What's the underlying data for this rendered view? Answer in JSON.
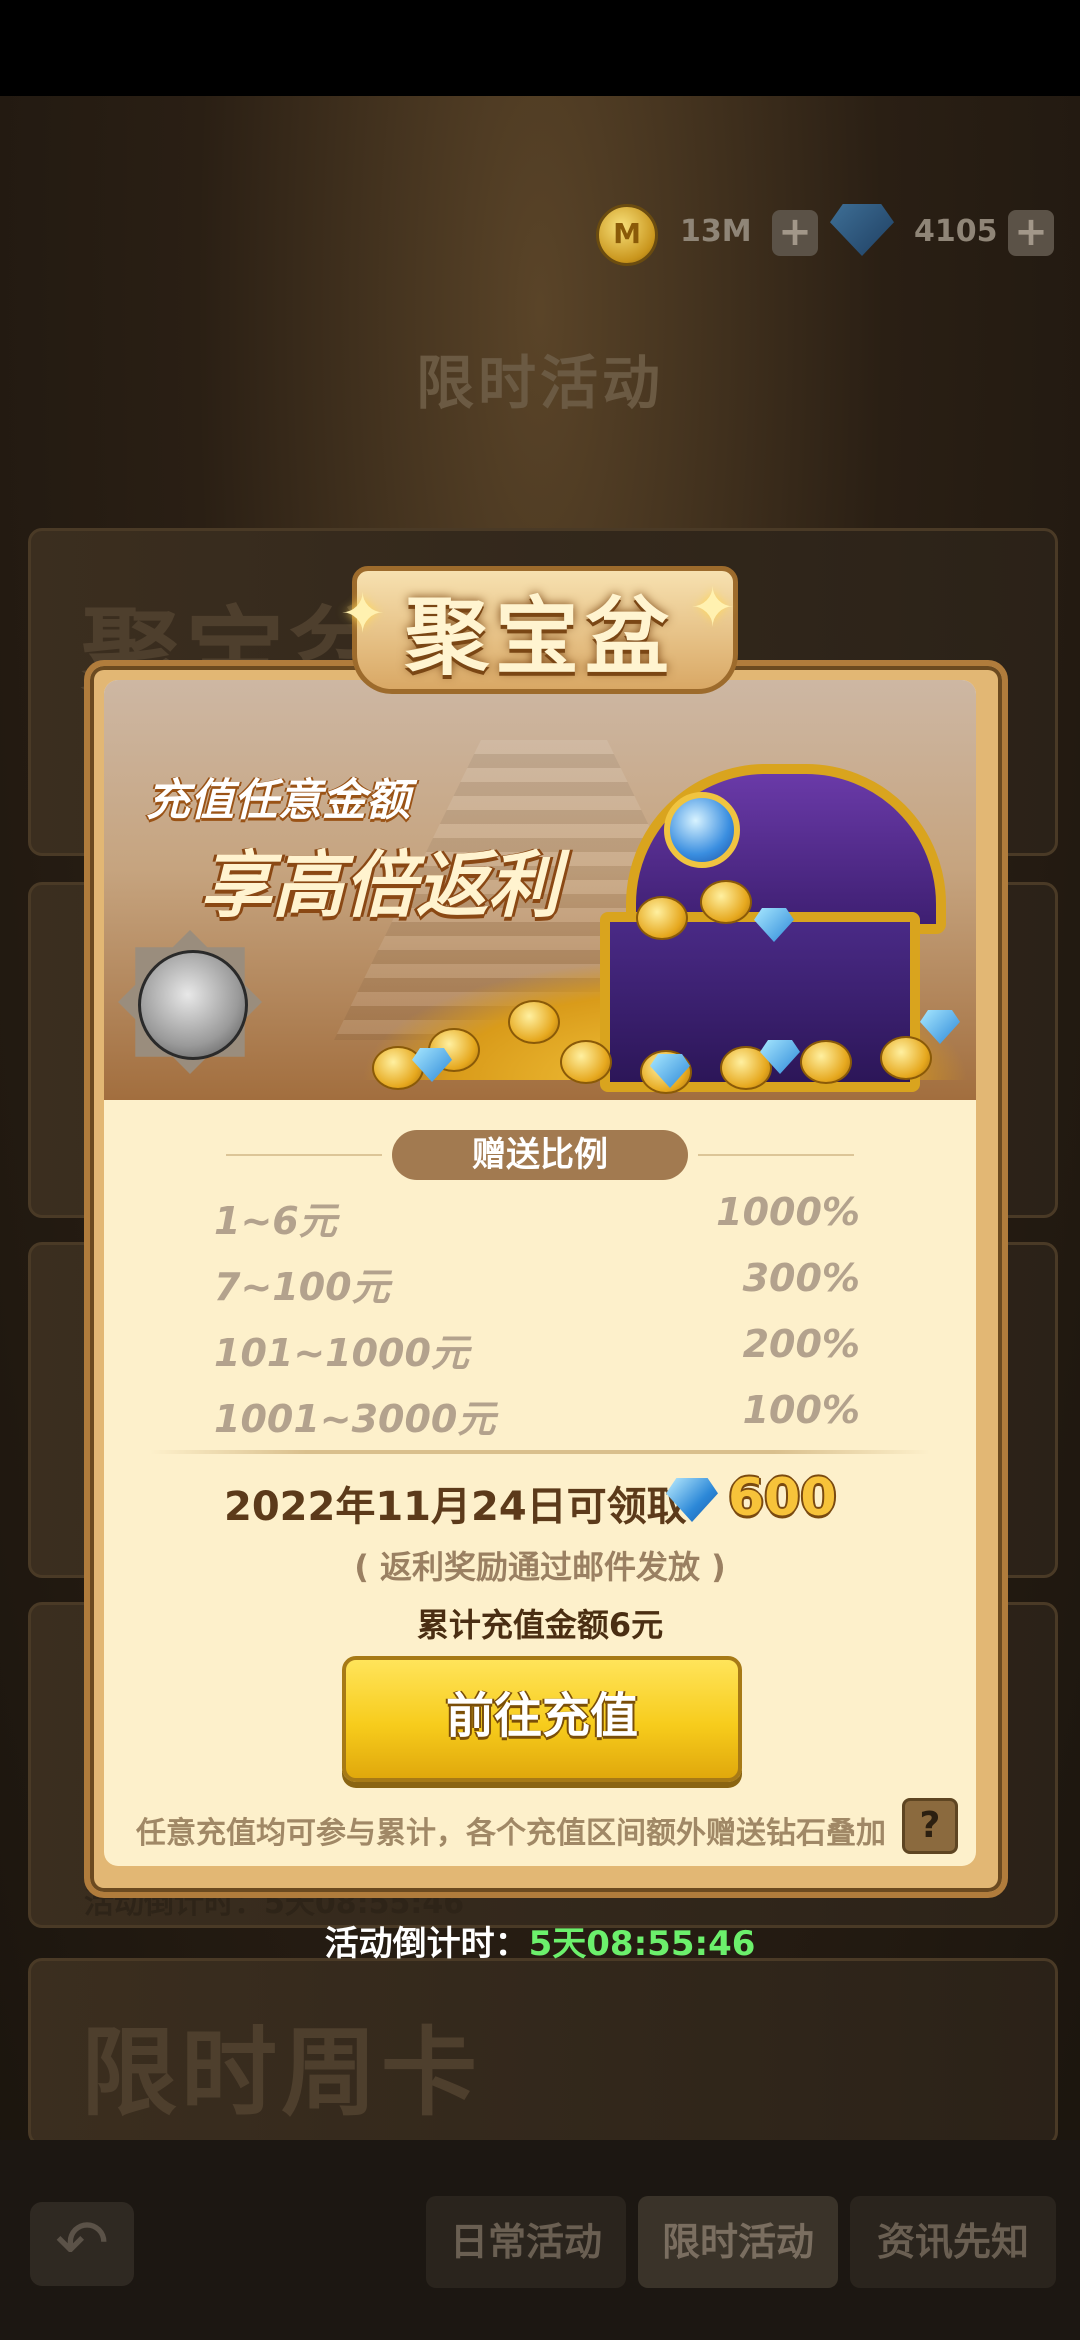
{
  "header": {
    "coins": "13M",
    "gems": "4105",
    "page_title": "限时活动"
  },
  "background": {
    "card1_title": "聚宝盆",
    "card_bottom_title": "限时周卡",
    "countdown_ghost": "活动倒计时：5天08:55:46"
  },
  "popup": {
    "title": "聚宝盆",
    "promo_line1": "充值任意金额",
    "promo_line2": "享高倍返利",
    "ratio_header": "赠送比例",
    "ratios": [
      {
        "range": "1~6元",
        "pct": "1000%"
      },
      {
        "range": "7~100元",
        "pct": "300%"
      },
      {
        "range": "101~1000元",
        "pct": "200%"
      },
      {
        "range": "1001~3000元",
        "pct": "100%"
      }
    ],
    "claim_text": "2022年11月24日可领取",
    "claim_amount": "600",
    "mail_note": "( 返利奖励通过邮件发放 )",
    "total_recharge": "累计充值金额6元",
    "go_button": "前往充值",
    "footer_note": "任意充值均可参与累计，各个充值区间额外赠送钻石叠加",
    "help": "?"
  },
  "countdown": {
    "label": "活动倒计时：",
    "value": "5天08:55:46"
  },
  "tabs": [
    {
      "label": "日常活动"
    },
    {
      "label": "限时活动"
    },
    {
      "label": "资讯先知"
    }
  ],
  "colors": {
    "countdown_value": "#6cf06c",
    "go_button": "#f7cc1c",
    "claim_amount": "#f7c33a"
  }
}
